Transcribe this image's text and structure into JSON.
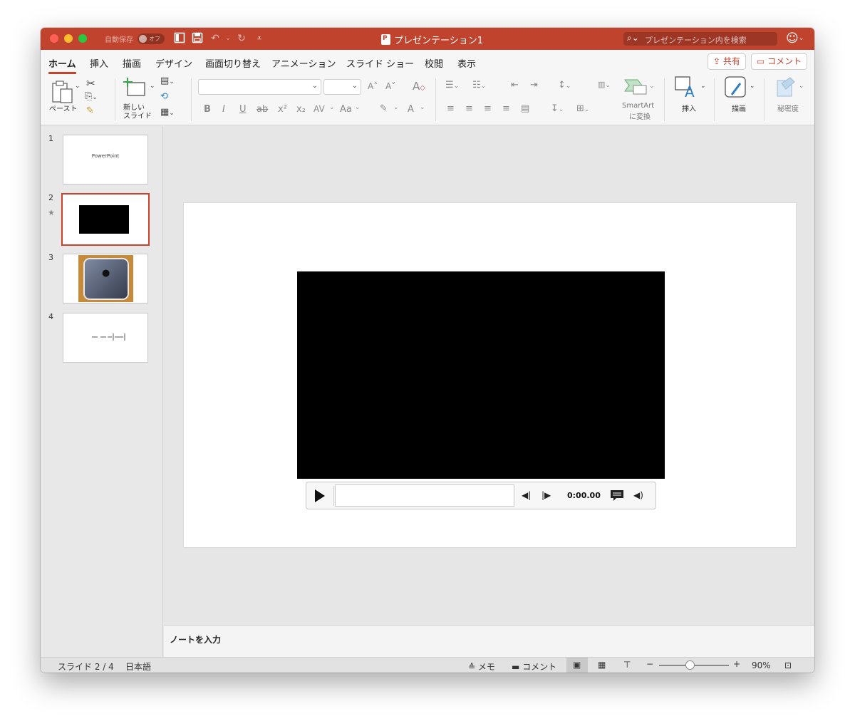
{
  "window": {
    "autosave_label": "自動保存",
    "autosave_state": "オフ",
    "title": "プレゼンテーション1",
    "search_placeholder": "プレゼンテーション内を検索"
  },
  "tabs": [
    "ホーム",
    "挿入",
    "描画",
    "デザイン",
    "画面切り替え",
    "アニメーション",
    "スライド ショー",
    "校閲",
    "表示"
  ],
  "active_tab": "ホーム",
  "share_label": "共有",
  "comment_label": "コメント",
  "ribbon": {
    "paste_label": "ペースト",
    "new_slide_label_1": "新しい",
    "new_slide_label_2": "スライド",
    "smartart_label_1": "SmartArt",
    "smartart_label_2": "に変換",
    "insert_label": "挿入",
    "draw_label": "描画",
    "sensitivity_label": "秘密度",
    "bold": "B",
    "italic": "I",
    "underline": "U",
    "strike": "ab",
    "superscript": "x²",
    "subscript": "x₂",
    "spacing": "AV",
    "case": "Aa",
    "font_color": "A"
  },
  "slides": [
    {
      "number": "1",
      "text": "PowerPoint"
    },
    {
      "number": "2",
      "text": ""
    },
    {
      "number": "3",
      "text": ""
    },
    {
      "number": "4",
      "text": ""
    }
  ],
  "player": {
    "time": "0:00.00"
  },
  "notes_placeholder": "ノートを入力",
  "status": {
    "slide_position": "スライド 2 / 4",
    "language": "日本語",
    "notes_label": "メモ",
    "comments_label": "コメント",
    "zoom": "90%",
    "zoom_level_fraction": 0.9
  },
  "colors": {
    "titlebar": "#c0432e",
    "accent": "#c0432e",
    "selected_border": "#d0412c"
  }
}
